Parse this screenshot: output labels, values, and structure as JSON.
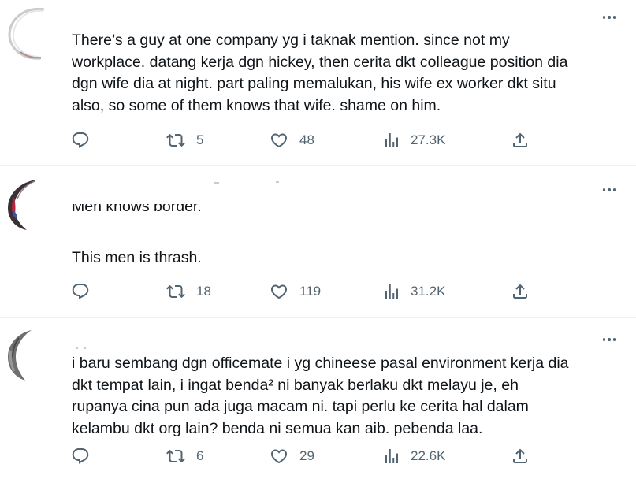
{
  "tweets": [
    {
      "text": "There’s a guy at one company yg i taknak mention. since not my\nworkplace. datang kerja dgn hickey, then cerita dkt colleague position dia\ndgn wife dia at night. part paling memalukan, his wife ex worker dkt situ\nalso, so some of them knows that wife. shame on him.",
      "replies": "",
      "retweets": "5",
      "likes": "48",
      "views": "27.3K"
    },
    {
      "text_clipped": "Men knows border.",
      "text": "\n\nThis men is thrash.",
      "replies": "",
      "retweets": "18",
      "likes": "119",
      "views": "31.2K"
    },
    {
      "text": "i baru sembang dgn officemate i yg chineese pasal environment kerja dia\ndkt tempat lain, i ingat benda² ni banyak berlaku dkt melayu je, eh\nrupanya cina pun ada juga macam ni. tapi perlu ke cerita hal dalam\nkelambu dkt org lain? benda ni semua kan aib. pebenda laa.",
      "replies": "",
      "retweets": "6",
      "likes": "29",
      "views": "22.6K"
    }
  ],
  "icons": {
    "reply": "reply-icon",
    "retweet": "retweet-icon",
    "like": "heart-icon",
    "views": "views-icon",
    "share": "share-icon",
    "more": "more-icon"
  },
  "colors": {
    "text": "#0f1419",
    "secondary": "#536471",
    "divider": "#eff3f4"
  }
}
